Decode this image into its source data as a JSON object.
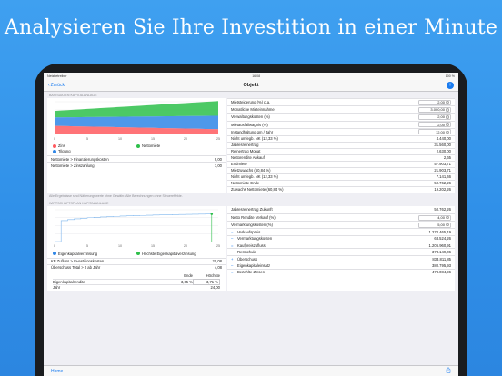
{
  "headline": "Analysieren Sie Ihre Investition in einer Minute",
  "status": {
    "left": "Netzbetreiber",
    "time": "16:08",
    "right": "100 %"
  },
  "nav": {
    "back": "Zurück",
    "title": "Objekt",
    "add": "+"
  },
  "section1": {
    "header": "BASISDATEN KAPITALANLAGE",
    "chart_data": {
      "type": "area",
      "x_ticks": [
        "0",
        "5",
        "10",
        "15",
        "20",
        "25"
      ],
      "series": [
        {
          "name": "Zins",
          "color": "#ff5a5f"
        },
        {
          "name": "Nettomiete",
          "color": "#2dbf4a"
        },
        {
          "name": "Tilgung",
          "color": "#2f86e6"
        }
      ]
    },
    "legend": [
      {
        "label": "Zins",
        "color": "#ff5a5f"
      },
      {
        "label": "Nettomiete",
        "color": "#2dbf4a"
      },
      {
        "label": "Tilgung",
        "color": "#2f86e6"
      }
    ],
    "left_rows": [
      {
        "label": "Nettomiete > Finanzierungskosten",
        "value": "9,00"
      },
      {
        "label": "Nettomiete > Zinszahlung",
        "value": "1,00"
      }
    ],
    "inputs": [
      {
        "label": "Mietsteigerung (%) p.a.",
        "value": "2,00"
      },
      {
        "label": "Monatliche Mieteinnahme",
        "value": "3.000,00"
      },
      {
        "label": "Verwaltungskosten (%)",
        "value": "2,00"
      },
      {
        "label": "Mietausfallwagnis (%)",
        "value": "2,00"
      },
      {
        "label": "Instandhaltung qm / Jahr",
        "value": "12,00"
      }
    ],
    "right_rows": [
      {
        "label": "Nicht umlegb. NK (12,33 %)",
        "value": "4.440,00"
      },
      {
        "label": "Jahresreinertrag",
        "value": "31.560,00"
      },
      {
        "label": "Reinertrag Monat",
        "value": "2.630,00"
      },
      {
        "label": "Nettorendite Ankauf",
        "value": "2,65"
      },
      {
        "label": "Endmiete",
        "value": "57.903,71"
      },
      {
        "label": "Mietzuwachs (60,84 %)",
        "value": "21.903,71"
      },
      {
        "label": "Nicht umlegb. NK (12,33 %)",
        "value": "7.141,46"
      },
      {
        "label": "Nettomiete Ende",
        "value": "50.762,26"
      },
      {
        "label": "Zuwachs Nettomiete (60,84 %)",
        "value": "19.202,26"
      }
    ]
  },
  "note": "Alle Ergebnisse sind Näherungswerte ohne Gewähr. Alle Berechnungen ohne Steuereffekte.",
  "section2": {
    "header": "WIRTSCHAFTSPLAN KAPITALANLAGE",
    "chart_data": {
      "type": "line",
      "x_ticks": [
        "0",
        "5",
        "10",
        "15",
        "20",
        "25"
      ],
      "series": [
        {
          "name": "Eigenkapitalverzinsung",
          "color": "#2f86e6"
        },
        {
          "name": "Höchste Eigenkapitalverzinsung",
          "color": "#2dbf4a"
        }
      ]
    },
    "legend": [
      {
        "label": "Eigenkapitalverzinsung",
        "color": "#2f86e6"
      },
      {
        "label": "Höchste Eigenkapitalverzinsung",
        "color": "#2dbf4a"
      }
    ],
    "left_rows": [
      {
        "label": "KP Zufluss > Investitionskosten",
        "value": "20,08"
      },
      {
        "label": "Überschuss Total > 0 ab Jahr",
        "value": "4,08"
      }
    ],
    "small_table": {
      "headers": [
        "",
        "Ende",
        "Höchste"
      ],
      "rows": [
        {
          "label": "Eigenkapitalrendite",
          "end": "3,65 %",
          "max": "3,71 %"
        },
        {
          "label": "Jahr",
          "end": "",
          "max": "24,00"
        }
      ]
    },
    "right_top": {
      "label": "Jahresreinertrag Zukunft",
      "value": "50.762,26"
    },
    "inputs": [
      {
        "label": "Netto Rendite Verkauf (%)",
        "value": "4,00"
      },
      {
        "label": "Vermarktungskosten (%)",
        "value": "5,00"
      }
    ],
    "calc_rows": [
      {
        "sign": "=",
        "label": "Verkaufspreis",
        "value": "1.270.465,19"
      },
      {
        "sign": "–",
        "label": "Vermarktungskosten",
        "value": "63.524,26"
      },
      {
        "sign": "=",
        "label": "Kaufpreiszufluss",
        "value": "1.206.960,91"
      },
      {
        "sign": "–",
        "label": "Restschuld",
        "value": "373.149,06"
      },
      {
        "sign": "+",
        "label": "Überschuss",
        "value": "833.811,85"
      },
      {
        "sign": "–",
        "label": "Eigenkapitaleinsatz",
        "value": "380.795,93"
      },
      {
        "sign": "=",
        "label": "Bezahlte Zinsen",
        "value": "478.084,96"
      }
    ]
  },
  "toolbar": {
    "home": "Home"
  }
}
